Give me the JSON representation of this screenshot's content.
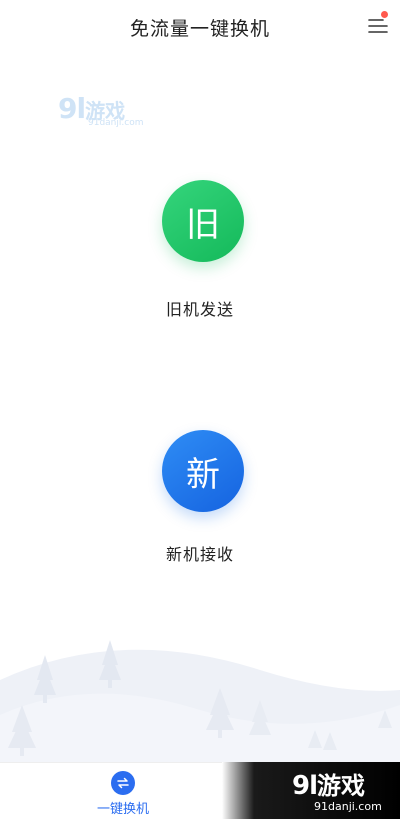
{
  "header": {
    "title": "免流量一键换机",
    "menu_icon": "menu-icon",
    "notification_color": "#ff5a4e"
  },
  "watermark": {
    "logo_number": "9l",
    "logo_text": "游戏",
    "url": "91danji.com"
  },
  "actions": {
    "old_phone": {
      "glyph": "旧",
      "label": "旧机发送",
      "color": "#1fc265"
    },
    "new_phone": {
      "glyph": "新",
      "label": "新机接收",
      "color": "#1f74eb"
    }
  },
  "tabbar": {
    "active_tab": {
      "label": "一键换机",
      "icon": "swap-icon",
      "color": "#2b6df0"
    }
  }
}
